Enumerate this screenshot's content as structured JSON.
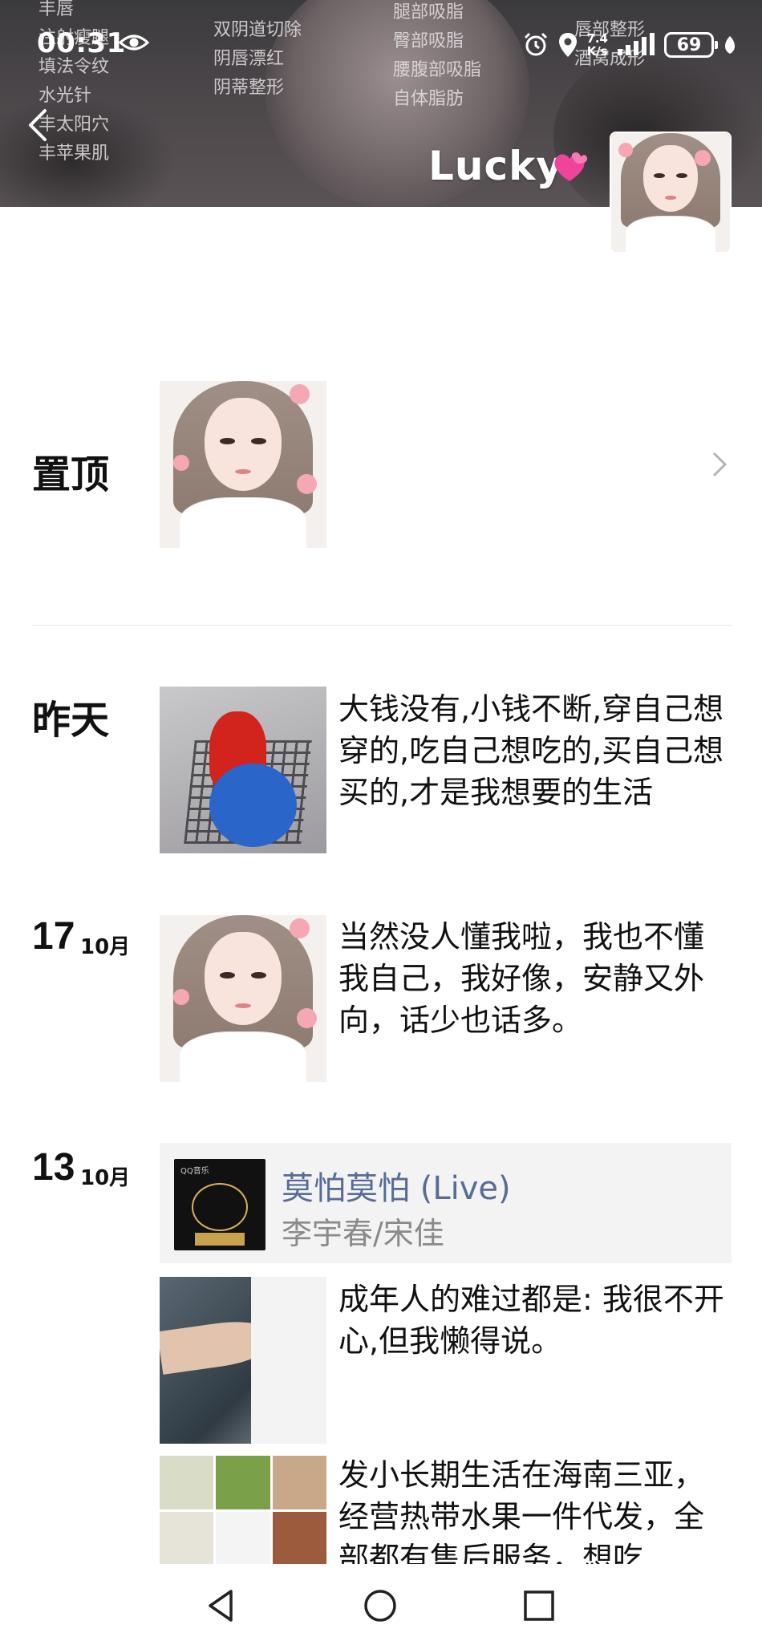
{
  "status_bar": {
    "time": "00:31",
    "net_speed_value": "7.4",
    "net_speed_unit": "K/s",
    "battery": "69"
  },
  "cover": {
    "overlay_col1": "丰唇\n注射瘦腿\n填法令纹\n水光针\n丰太阳穴\n丰苹果肌",
    "overlay_col2": "双阴道切除\n阴唇漂红\n阴蒂整形",
    "overlay_col3": "腿部吸脂\n臀部吸脂\n腰腹部吸脂\n自体脂肪",
    "overlay_col4": "唇部整形\n酒窝成形"
  },
  "profile": {
    "nickname": "Lucky"
  },
  "feed": {
    "pinned_label": "置顶",
    "yesterday_label": "昨天",
    "yesterday_text": "大钱没有,小钱不断,穿自己想穿的,吃自己想吃的,买自己想买的,才是我想要的生活",
    "oct17_day": "17",
    "oct17_month": "10月",
    "oct17_text": "当然没人懂我啦，我也不懂我自己，我好像，安静又外向，话少也话多。",
    "oct13_day": "13",
    "oct13_month": "10月",
    "music_title": "莫怕莫怕 (Live)",
    "music_artist": "李宇春/宋佳",
    "music_app": "QQ音乐",
    "arm_text": "成年人的难过都是: 我很不开心,但我懒得说。",
    "fruit_text": "发小长期生活在海南三亚，经营热带水果一件代发，全部都有售后服务，想吃"
  },
  "colors": {
    "link": "#576b95",
    "divider": "#e6e6e6",
    "music_card_bg": "#f3f3f3"
  },
  "icons": [
    "eye-icon",
    "alarm-icon",
    "location-icon",
    "signal-icon",
    "battery-icon",
    "back-arrow-icon",
    "heart-icon",
    "chevron-right-icon",
    "nav-back-icon",
    "nav-home-icon",
    "nav-recents-icon"
  ]
}
